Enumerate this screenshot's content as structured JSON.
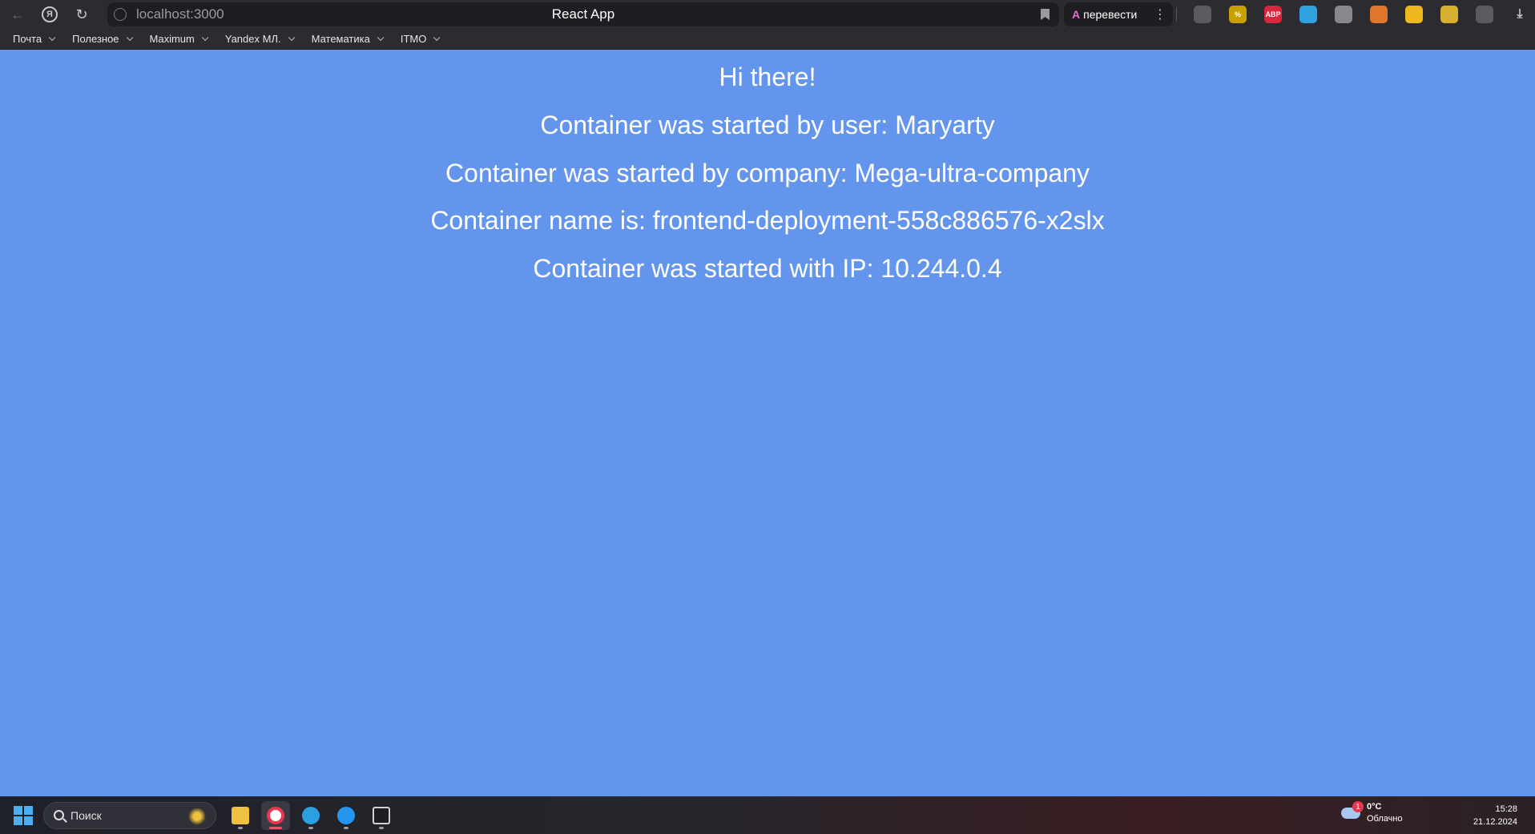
{
  "browser": {
    "url": "localhost:3000",
    "tab_title": "React App",
    "translate_label": "перевести",
    "translate_glyph": "A",
    "more_glyph": "⋮",
    "yandex_glyph": "Я",
    "back_glyph": "←",
    "reload_glyph": "↻",
    "download_glyph": "⤓",
    "extensions": [
      {
        "name": "dark-mode-icon",
        "text": "",
        "color": "#5a5a60"
      },
      {
        "name": "coupon-icon",
        "text": "%",
        "color": "#c8a000"
      },
      {
        "name": "adblock-icon",
        "text": "ABP",
        "color": "#d8263c"
      },
      {
        "name": "color-picker-icon",
        "text": "",
        "color": "#2fa0e0"
      },
      {
        "name": "vpn-globe-icon",
        "text": "",
        "color": "#88888c"
      },
      {
        "name": "metamask-icon",
        "text": "",
        "color": "#e0762c"
      },
      {
        "name": "honey-icon",
        "text": "",
        "color": "#f0b820"
      },
      {
        "name": "battery-icon",
        "text": "",
        "color": "#d8b030"
      },
      {
        "name": "puzzle-icon",
        "text": "",
        "color": "#5a5a60"
      }
    ]
  },
  "bookmarks": [
    {
      "label": "Почта"
    },
    {
      "label": "Полезное"
    },
    {
      "label": "Maximum"
    },
    {
      "label": "Yandex МЛ."
    },
    {
      "label": "Математика"
    },
    {
      "label": "ITMO"
    }
  ],
  "page": {
    "greeting": "Hi there!",
    "user_line": "Container was started by user: Maryarty",
    "company_line": "Container was started by company: Mega-ultra-company",
    "name_line": "Container name is: frontend-deployment-558c886576-x2slx",
    "ip_line": "Container was started with IP: 10.244.0.4",
    "background": "#6495ED"
  },
  "taskbar": {
    "search_placeholder": "Поиск",
    "apps": [
      {
        "name": "file-explorer-icon",
        "active": false
      },
      {
        "name": "yandex-browser-icon",
        "active": true
      },
      {
        "name": "telegram-icon",
        "active": false
      },
      {
        "name": "docker-icon",
        "active": false
      },
      {
        "name": "terminal-icon",
        "active": false
      }
    ],
    "weather_temp": "0°C",
    "weather_desc": "Облачно",
    "weather_badge": "1",
    "time": "15:28",
    "date": "21.12.2024"
  }
}
